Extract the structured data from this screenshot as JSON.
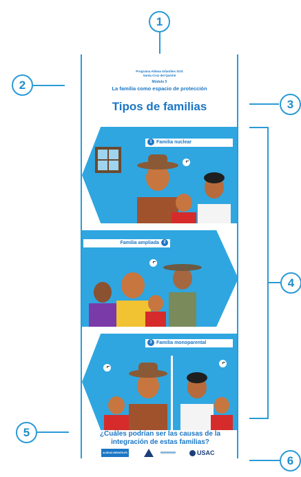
{
  "callouts": [
    "1",
    "2",
    "3",
    "4",
    "5",
    "6"
  ],
  "poster": {
    "org_line1": "Programa Aldeas Infantiles SOS",
    "org_line2": "Santa Cruz del Quiché",
    "module": "Módulo 5",
    "module_title": "La familia como espacio de protección",
    "title": "Tipos de familias",
    "families": [
      {
        "number": "1",
        "label": "Familia nuclear"
      },
      {
        "number": "2",
        "label": "Familia ampliada"
      },
      {
        "number": "3",
        "label": "Familia monoparental"
      }
    ],
    "question": "¿Cuáles podrían ser las causas de la integración de estas familias?",
    "logos": [
      "ALDEAS INFANTILES SOS",
      "",
      "USAC"
    ]
  },
  "colors": {
    "accent": "#2a9ad6",
    "panel": "#2fa6e0",
    "text": "#1b76c4"
  }
}
